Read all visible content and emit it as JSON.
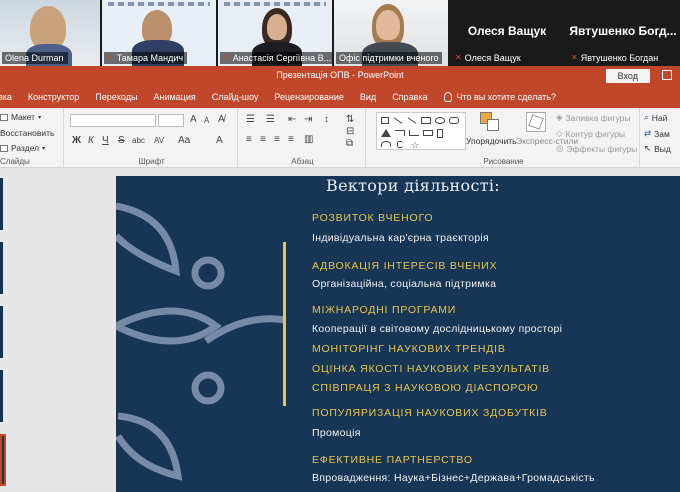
{
  "participants": [
    {
      "name": "Olena Durman",
      "muted": false
    },
    {
      "name": "Тамара Мандич",
      "muted": true
    },
    {
      "name": "Анастасія Сергіївна В...",
      "muted": true
    },
    {
      "name": "Офіс підтримки вченого",
      "muted": false
    },
    {
      "name": "Олеся Ващук",
      "label": "Олеся Ващук",
      "muted": true
    },
    {
      "name": "Явтушенко Богдан",
      "label": "Явтушенко Богд...",
      "muted": true
    }
  ],
  "window": {
    "title": "Презентація ОПВ  -  PowerPoint",
    "signin": "Вход"
  },
  "menu": {
    "tabs": [
      "вка",
      "Конструктор",
      "Переходы",
      "Анимация",
      "Слайд-шоу",
      "Рецензирование",
      "Вид",
      "Справка"
    ],
    "tellme": "Что вы хотите сделать?"
  },
  "ribbon": {
    "slides": {
      "layout": "Макет",
      "reset": "Восстановить",
      "section": "Раздел",
      "label": "Слайды"
    },
    "font": {
      "label": "Шрифт",
      "bold": "Ж",
      "italic": "К",
      "underline": "Ч",
      "strike": "S",
      "shadow": "abc",
      "spacing": "AV",
      "case": "Aa",
      "grow": "A",
      "shrink": "A"
    },
    "paragraph": {
      "label": "Абзац"
    },
    "drawing": {
      "arrange": "Упорядочить",
      "quickstyles": "Экспресс-стили",
      "fill": "Заливка фигуры",
      "outline": "Контур фигуры",
      "effects": "Эффекты фигуры",
      "label": "Рисование"
    },
    "editing": {
      "find": "Най",
      "replace": "Зам",
      "select": "Выд"
    }
  },
  "slide": {
    "title": "Вектори діяльності:",
    "items": [
      {
        "heading": "РОЗВИТОК ВЧЕНОГО",
        "detail": "Індивідуальна кар'єрна траєкторія"
      },
      {
        "heading": "АДВОКАЦІЯ ІНТЕРЕСІВ ВЧЕНИХ",
        "detail": " Організаційна, соціальна підтримка"
      },
      {
        "heading": "МІЖНАРОДНІ ПРОГРАМИ",
        "detail": "Кооперації в світовому дослідницькому просторі"
      },
      {
        "heading": "МОНІТОРІНГ НАУКОВИХ ТРЕНДІВ",
        "detail": ""
      },
      {
        "heading": "ОЦІНКА ЯКОСТІ НАУКОВИХ РЕЗУЛЬТАТІВ",
        "detail": ""
      },
      {
        "heading": "СПІВПРАЦЯ З НАУКОВОЮ ДІАСПОРОЮ",
        "detail": ""
      },
      {
        "heading": "ПОПУЛЯРИЗАЦІЯ НАУКОВИХ ЗДОБУТКІВ",
        "detail": "Промоція"
      },
      {
        "heading": "ЕФЕКТИВНЕ ПАРТНЕРСТВО",
        "detail": "Впровадження: Наука+Бізнес+Держава+Громадськість"
      }
    ]
  },
  "colors": {
    "accent": "#c1472b",
    "slide_bg": "#173555",
    "slide_gold": "#e9c54a"
  }
}
